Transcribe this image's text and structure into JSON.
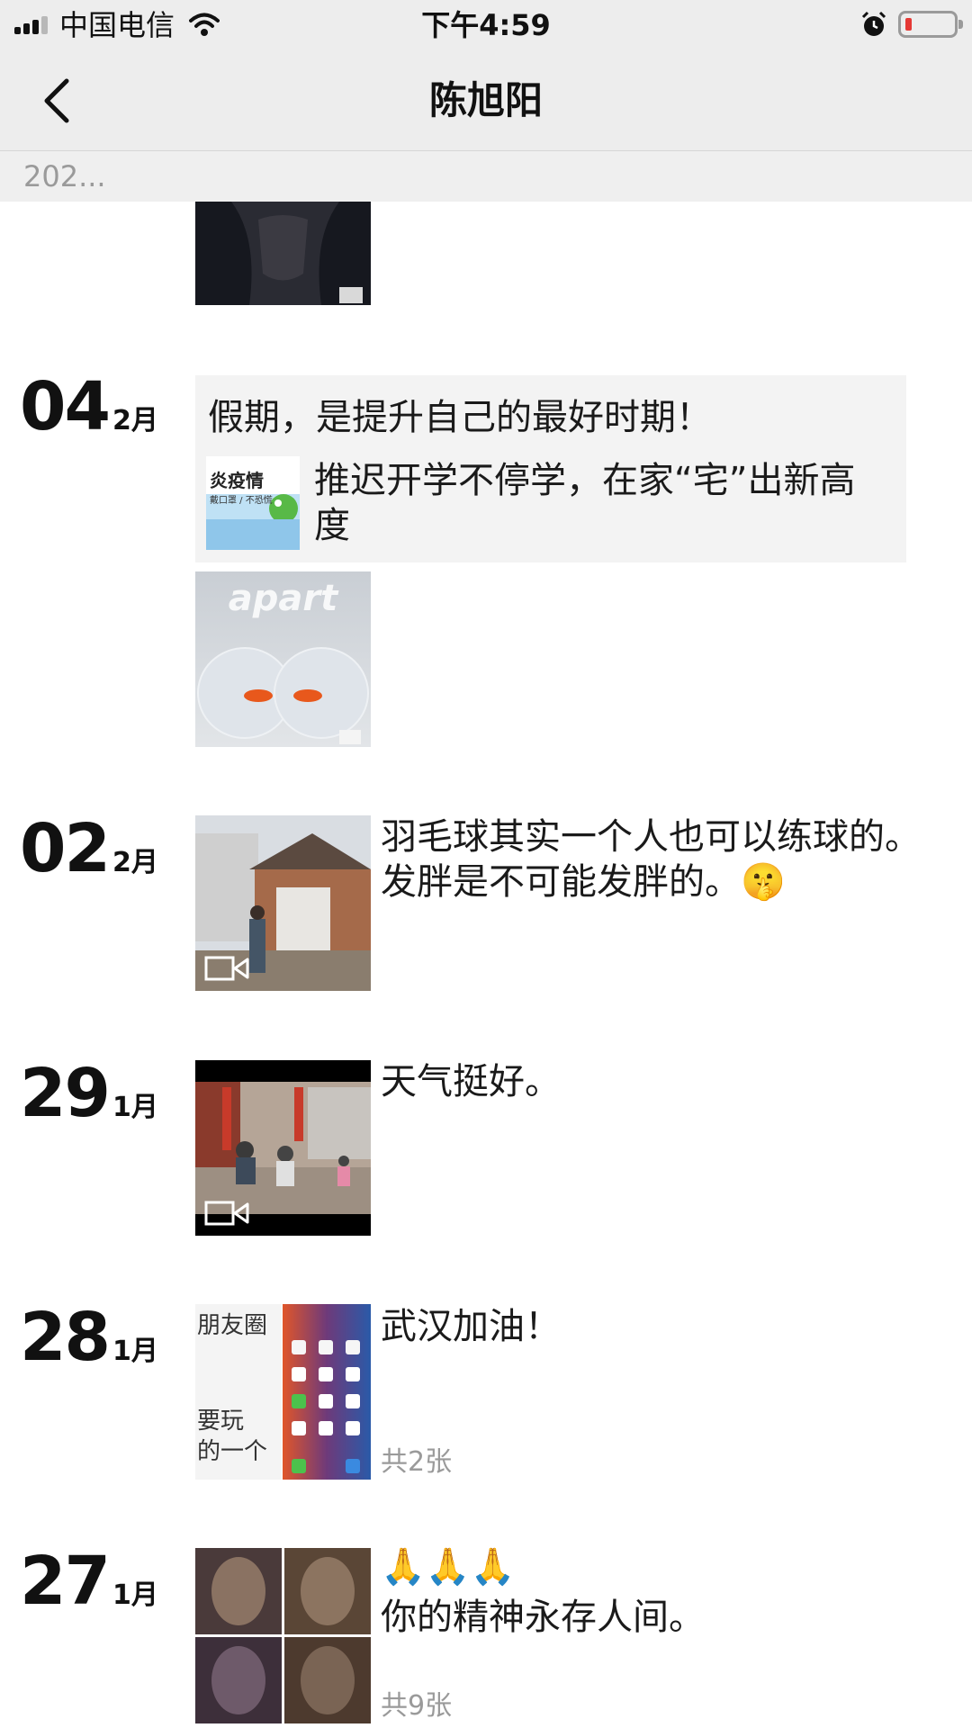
{
  "status_bar": {
    "carrier": "中国电信",
    "time": "下午4:59"
  },
  "nav": {
    "title": "陈旭阳"
  },
  "year_header": "202...",
  "posts": [
    {
      "day": "04",
      "month": "2月",
      "share_title": "假期，是提升自己的最好时期！",
      "share_desc": "推迟开学不停学，在家“宅”出新高度",
      "share_thumb_text": [
        "炎疫情",
        "戴口罩 / 不恐慌"
      ],
      "image_text": "apart"
    },
    {
      "day": "02",
      "month": "2月",
      "text": "羽毛球其实一个人也可以练球的。发胖是不可能发胖的。🤫"
    },
    {
      "day": "29",
      "month": "1月",
      "text": "天气挺好。"
    },
    {
      "day": "28",
      "month": "1月",
      "text": "武汉加油！",
      "image_caption": [
        "朋友圈",
        "要玩",
        "的一个"
      ],
      "count": "共2张"
    },
    {
      "day": "27",
      "month": "1月",
      "text_line1": "🙏🙏🙏",
      "text_line2": "你的精神永存人间。",
      "count": "共9张"
    }
  ]
}
